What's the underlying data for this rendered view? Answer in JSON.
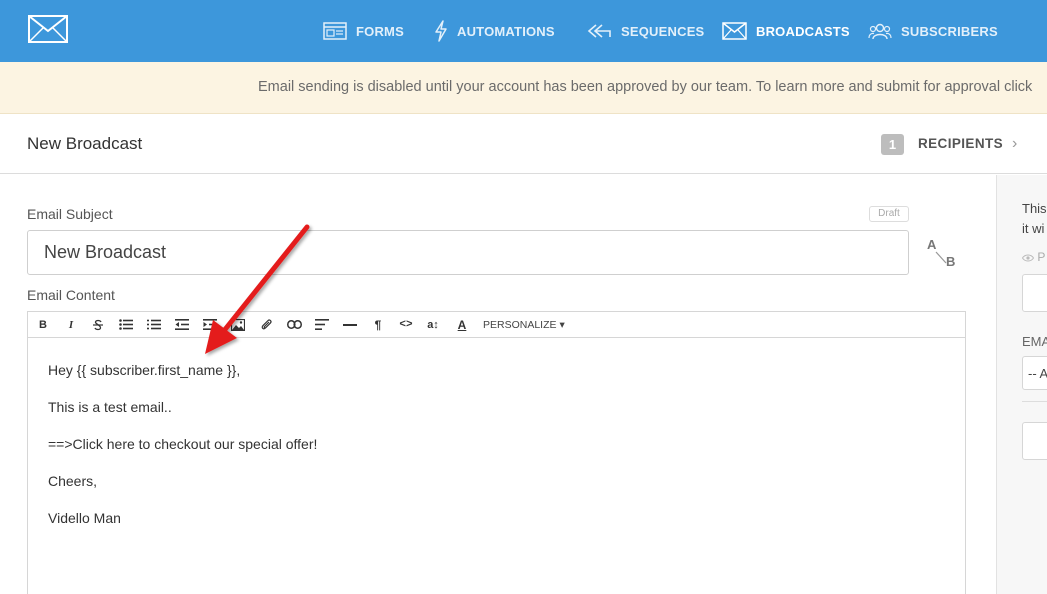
{
  "nav": {
    "logo": "mail-logo",
    "items": [
      {
        "label": "FORMS",
        "icon": "forms-icon",
        "active": false
      },
      {
        "label": "AUTOMATIONS",
        "icon": "lightning-icon",
        "active": false
      },
      {
        "label": "SEQUENCES",
        "icon": "sequences-icon",
        "active": false
      },
      {
        "label": "BROADCASTS",
        "icon": "envelope-icon",
        "active": true
      },
      {
        "label": "SUBSCRIBERS",
        "icon": "users-icon",
        "active": false
      }
    ]
  },
  "alert": {
    "text": "Email sending is disabled until your account has been approved by our team. To learn more and submit for approval click"
  },
  "header": {
    "title": "New Broadcast",
    "step_number": "1",
    "step_label": "RECIPIENTS",
    "step_chevron": "›"
  },
  "form": {
    "subject_label": "Email Subject",
    "draft_badge": "Draft",
    "subject_value": "New Broadcast",
    "ab_top": "A",
    "ab_bottom": "B",
    "content_label": "Email Content"
  },
  "toolbar": {
    "bold": "B",
    "italic": "I",
    "personalize": "PERSONALIZE ▾",
    "paragraph": "¶",
    "code": "<>",
    "font_color": "A",
    "font_size": "a↕"
  },
  "editor": {
    "lines": [
      "Hey {{ subscriber.first_name }},",
      "This is a test email..",
      "==>Click here to checkout our special offer!",
      "Cheers,",
      "Vidello Man"
    ]
  },
  "right_panel": {
    "line1": "This",
    "line2": "it wi",
    "preview_label": "P",
    "email_label": "EMA",
    "select_value": "-- A"
  },
  "colors": {
    "nav_bg": "#3d97db",
    "alert_bg": "#fcf4e2",
    "annotation_arrow": "#e41e1e"
  }
}
